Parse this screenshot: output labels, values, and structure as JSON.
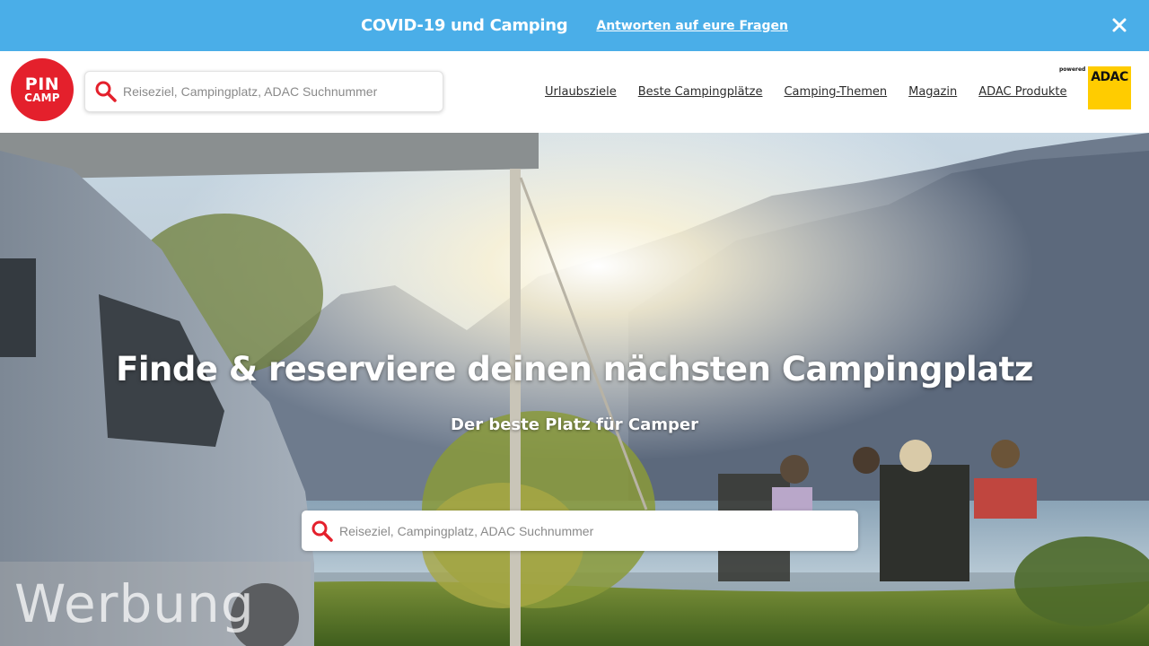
{
  "banner": {
    "title": "COVID-19 und Camping",
    "link_label": "Antworten auf eure Fragen",
    "close_icon": "close-icon",
    "background_color": "#4aaee8"
  },
  "header": {
    "logo": {
      "line1": "PIN",
      "line2": "CAMP",
      "color": "#e4202c"
    },
    "search": {
      "placeholder": "Reiseziel, Campingplatz, ADAC Suchnummer",
      "value": ""
    },
    "nav": [
      "Urlaubsziele",
      "Beste Campingplätze",
      "Camping-Themen",
      "Magazin",
      "ADAC Produkte"
    ],
    "partner": {
      "powered_by": "powered by",
      "name": "ADAC",
      "color": "#ffcc00"
    }
  },
  "hero": {
    "title": "Finde & reserviere deinen nächsten Campingplatz",
    "subtitle": "Der beste Platz für Camper",
    "search": {
      "placeholder": "Reiseziel, Campingplatz, ADAC Suchnummer",
      "value": ""
    }
  },
  "ad_label": "Werbung"
}
